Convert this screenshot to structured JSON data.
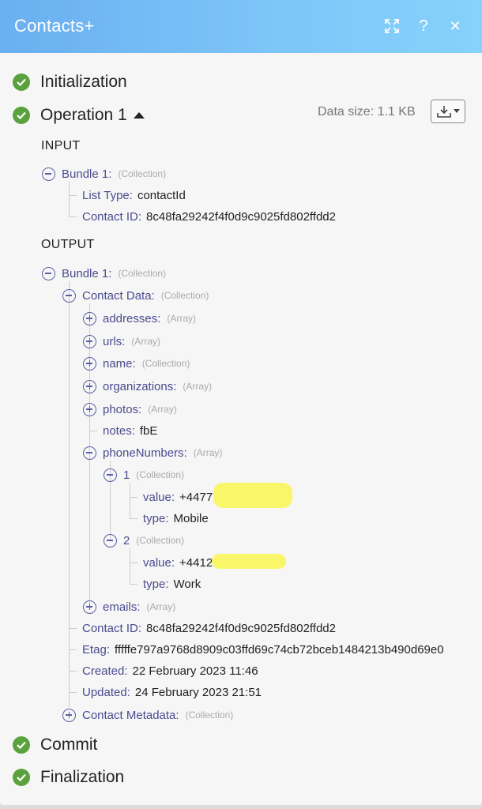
{
  "header": {
    "title": "Contacts+",
    "expand_icon": "expand-icon",
    "help_label": "?",
    "close_label": "✕"
  },
  "statuses": {
    "initialization": "Initialization",
    "operation": "Operation 1",
    "commit": "Commit",
    "finalization": "Finalization"
  },
  "data_size": "Data size: 1.1 KB",
  "input": {
    "label": "INPUT",
    "bundle_key": "Bundle 1",
    "bundle_type": "(Collection)",
    "list_type_key": "List Type",
    "list_type_val": "contactId",
    "contact_id_key": "Contact ID",
    "contact_id_val": "8c48fa29242f4f0d9c9025fd802ffdd2"
  },
  "output": {
    "label": "OUTPUT",
    "bundle_key": "Bundle 1",
    "bundle_type": "(Collection)",
    "contact_data_key": "Contact Data",
    "contact_data_type": "(Collection)",
    "addresses_key": "addresses",
    "addresses_type": "(Array)",
    "urls_key": "urls",
    "urls_type": "(Array)",
    "name_key": "name",
    "name_type": "(Collection)",
    "organizations_key": "organizations",
    "organizations_type": "(Array)",
    "photos_key": "photos",
    "photos_type": "(Array)",
    "notes_key": "notes",
    "notes_val": "fbE",
    "phone_numbers_key": "phoneNumbers",
    "phone_numbers_type": "(Array)",
    "phones": [
      {
        "index": "1",
        "type_label": "(Collection)",
        "value_key": "value",
        "value_val": "+4477",
        "type_key": "type",
        "type_val": "Mobile"
      },
      {
        "index": "2",
        "type_label": "(Collection)",
        "value_key": "value",
        "value_val": "+4412",
        "type_key": "type",
        "type_val": "Work"
      }
    ],
    "emails_key": "emails",
    "emails_type": "(Array)",
    "contact_id_key": "Contact ID",
    "contact_id_val": "8c48fa29242f4f0d9c9025fd802ffdd2",
    "etag_key": "Etag",
    "etag_val": "fffffe797a9768d8909c03ffd69c74cb72bceb1484213b490d69e0",
    "created_key": "Created",
    "created_val": "22 February 2023 11:46",
    "updated_key": "Updated",
    "updated_val": "24 February 2023 21:51",
    "metadata_key": "Contact Metadata",
    "metadata_type": "(Collection)"
  },
  "colors": {
    "header_start": "#6aaff0",
    "header_end": "#86d2fb",
    "success": "#5aa23d",
    "key": "#4b4b8f",
    "redaction": "#faf66a"
  }
}
